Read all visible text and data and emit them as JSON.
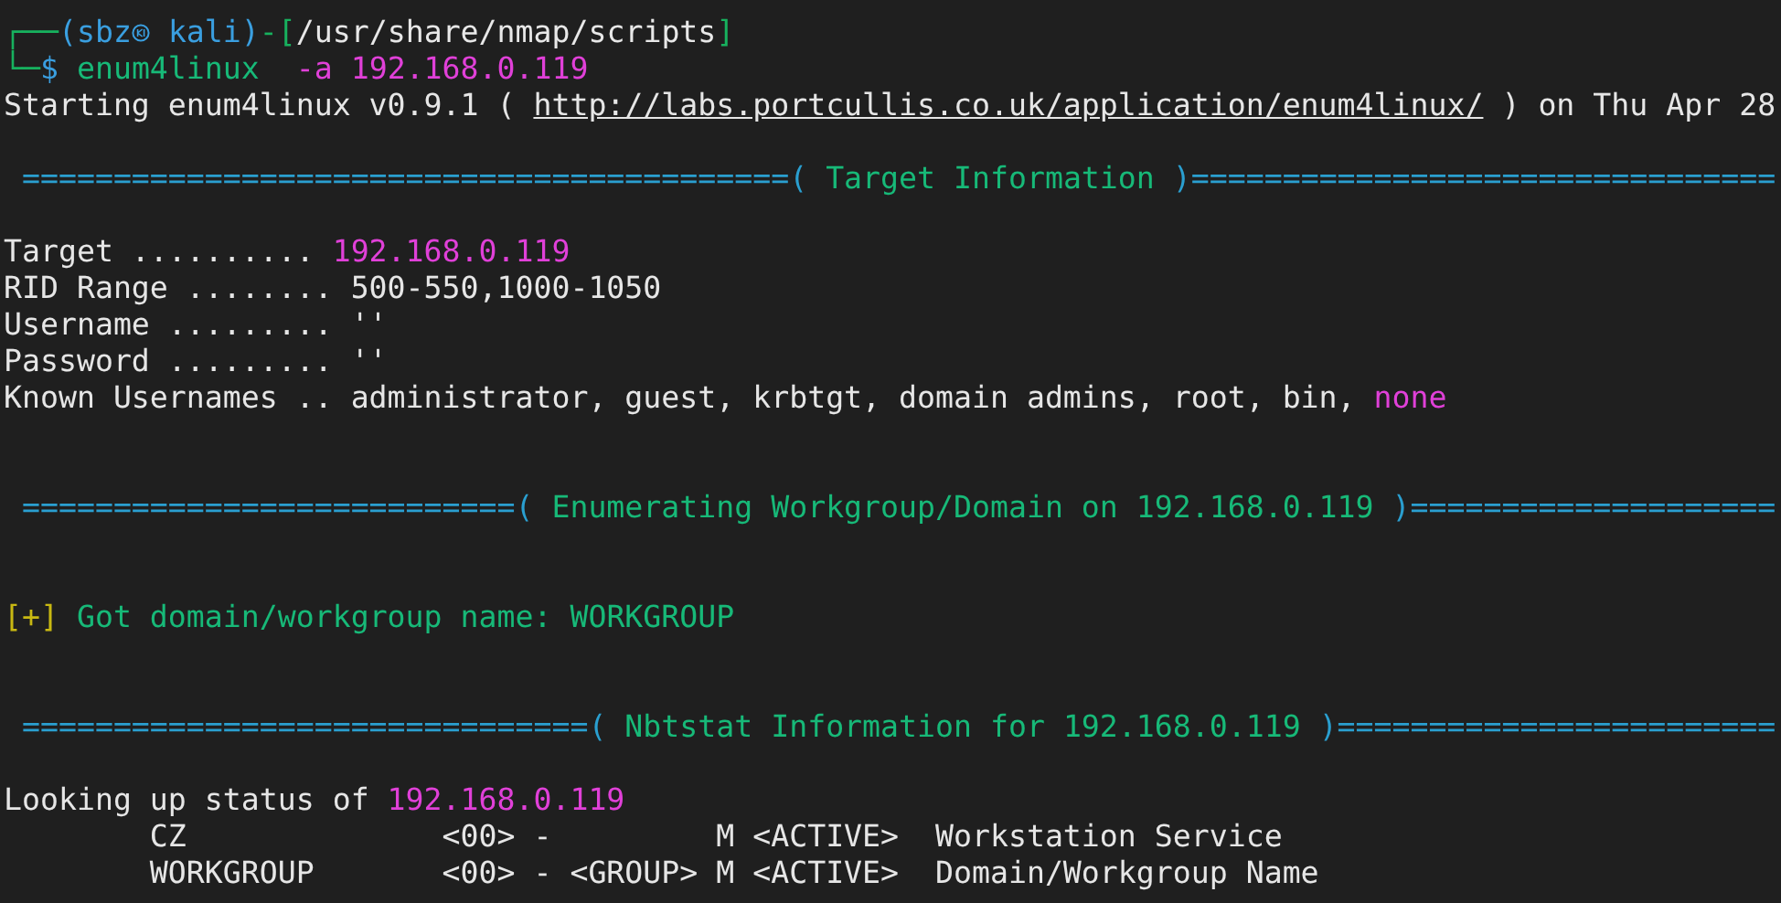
{
  "terminal": {
    "lines": [
      {
        "kind": "text",
        "parts": [
          {
            "kind": "frame",
            "text": "┌──"
          },
          {
            "kind": "user",
            "text": "(sbz"
          },
          {
            "kind": "host",
            "text": " kali)"
          },
          {
            "kind": "frame",
            "text": "-["
          },
          {
            "kind": "path",
            "text": "/usr/share/nmap/scripts"
          },
          {
            "kind": "frame",
            "text": "]"
          }
        ]
      },
      {
        "kind": "text",
        "parts": [
          {
            "kind": "frame",
            "text": "└─"
          },
          {
            "kind": "user",
            "text": "$"
          },
          {
            "kind": "command",
            "text": " enum4linux"
          },
          {
            "kind": "argument",
            "text": "  -a 192.168.0.119"
          }
        ]
      },
      {
        "kind": "text",
        "parts": [
          {
            "kind": "plain",
            "text": "Starting enum4linux v0.9.1 ( "
          },
          {
            "kind": "link",
            "text": "http://labs.portcullis.co.uk/application/enum4linux/"
          },
          {
            "kind": "plain",
            "text": " ) on Thu Apr 28"
          }
        ]
      },
      {
        "kind": "blank"
      },
      {
        "kind": "text",
        "parts": [
          {
            "kind": "rule",
            "text": " ==========================================("
          },
          {
            "kind": "heading",
            "text": " Target Information "
          },
          {
            "kind": "rule",
            "text": ")================================"
          }
        ]
      },
      {
        "kind": "blank"
      },
      {
        "kind": "text",
        "parts": [
          {
            "kind": "plain",
            "text": "Target .......... "
          },
          {
            "kind": "address",
            "text": "192.168.0.119"
          }
        ]
      },
      {
        "kind": "text",
        "parts": [
          {
            "kind": "plain",
            "text": "RID Range ........ 500-550,1000-1050"
          }
        ]
      },
      {
        "kind": "text",
        "parts": [
          {
            "kind": "plain",
            "text": "Username ......... ''"
          }
        ]
      },
      {
        "kind": "text",
        "parts": [
          {
            "kind": "plain",
            "text": "Password ......... ''"
          }
        ]
      },
      {
        "kind": "text",
        "parts": [
          {
            "kind": "plain",
            "text": "Known Usernames .. administrator, guest, krbtgt, domain admins, root, bin, "
          },
          {
            "kind": "address",
            "text": "none"
          }
        ]
      },
      {
        "kind": "blank"
      },
      {
        "kind": "blank"
      },
      {
        "kind": "text",
        "parts": [
          {
            "kind": "rule",
            "text": " ===========================("
          },
          {
            "kind": "heading",
            "text": " Enumerating Workgroup/Domain on 192.168.0.119 "
          },
          {
            "kind": "rule",
            "text": ")===================="
          }
        ]
      },
      {
        "kind": "blank"
      },
      {
        "kind": "blank"
      },
      {
        "kind": "text",
        "parts": [
          {
            "kind": "mark",
            "text": "[+]"
          },
          {
            "kind": "message",
            "text": " Got domain/workgroup name: WORKGROUP"
          }
        ]
      },
      {
        "kind": "blank"
      },
      {
        "kind": "blank"
      },
      {
        "kind": "text",
        "parts": [
          {
            "kind": "rule",
            "text": " ===============================("
          },
          {
            "kind": "heading",
            "text": " Nbtstat Information for 192.168.0.119 "
          },
          {
            "kind": "rule",
            "text": ")========================"
          }
        ]
      },
      {
        "kind": "blank"
      },
      {
        "kind": "text",
        "parts": [
          {
            "kind": "plain",
            "text": "Looking up status of "
          },
          {
            "kind": "address",
            "text": "192.168.0.119"
          }
        ]
      },
      {
        "kind": "text",
        "parts": [
          {
            "kind": "plain",
            "text": "        CZ              <00> -         M <ACTIVE>  Workstation Service"
          }
        ]
      },
      {
        "kind": "text",
        "parts": [
          {
            "kind": "plain",
            "text": "        WORKGROUP       <00> - <GROUP> M <ACTIVE>  Domain/Workgroup Name"
          }
        ]
      }
    ]
  }
}
